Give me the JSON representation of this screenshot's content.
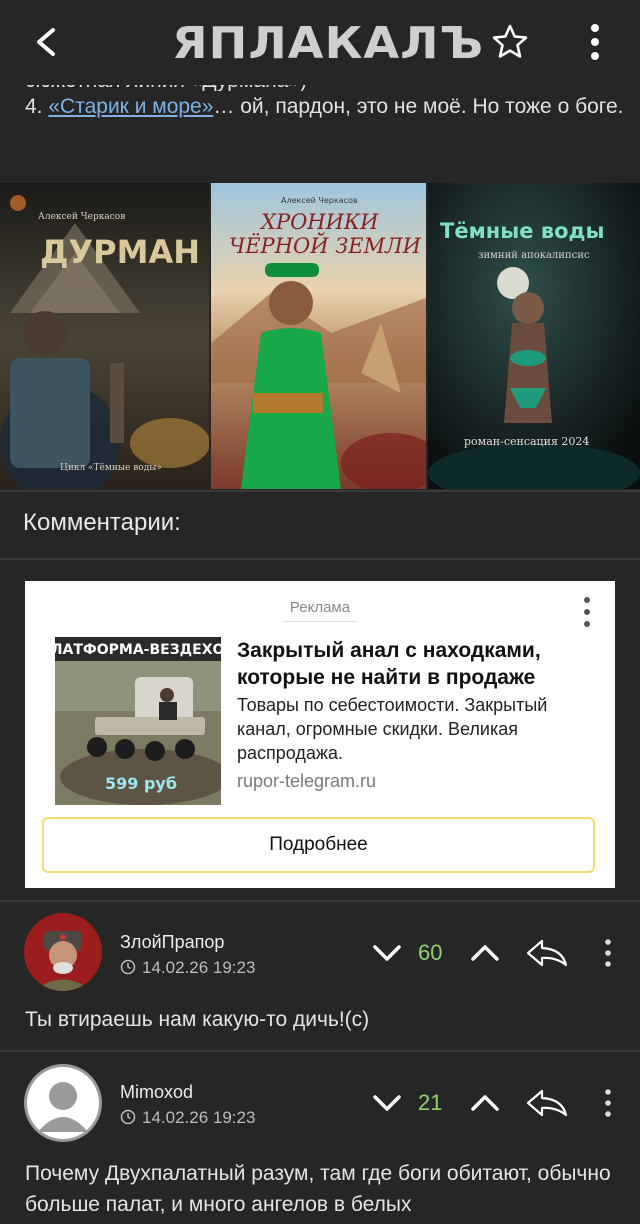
{
  "header": {
    "logo_text": "ЯПЛАКАЛЪ"
  },
  "post": {
    "line_clipped": "сюжетная линия «Дурмана»)",
    "line4_prefix": "4. ",
    "line4_link": "«Старик и море»",
    "line4_rest": "… ой, пардон, это не моё. Но тоже о боге."
  },
  "covers": [
    {
      "author": "Алексей Черкасов",
      "title": "ДУРМАН",
      "footer": "Цикл «Тёмные воды»"
    },
    {
      "author": "Алексей Черкасов",
      "title_line1": "ХРОНИКИ",
      "title_line2": "ЧЁРНОЙ ЗЕМЛИ"
    },
    {
      "title": "Тёмные воды",
      "subtitle": "зимний апокалипсис",
      "footer": "роман-сенсация 2024"
    }
  ],
  "comments_title": "Комментарии:",
  "ad": {
    "label": "Реклама",
    "thumb_banner": "ПЛАТФОРМА-ВЕЗДЕХОД",
    "thumb_price": "599 руб",
    "headline": "Закрытый анал с находками, которые не найти в продаже",
    "description": "Товары по себестоимости. Закрытый канал, огромные скидки. Великая распродажа.",
    "domain": "rupor-telegram.ru",
    "button": "Подробнее"
  },
  "comments": [
    {
      "author": "ЗлойПрапор",
      "date": "14.02.26 19:23",
      "score": "60",
      "text": "Ты втираешь нам какую-то дичь!(с)"
    },
    {
      "author": "Mimoxod",
      "date": "14.02.26 19:23",
      "score": "21",
      "text": "Почему Двухпалатный разум, там где боги обитают, обычно больше палат, и много ангелов в белых"
    }
  ],
  "colors": {
    "background": "#262626",
    "link": "#7fb0e6",
    "score": "#8fd16b",
    "ad_button_border": "#f2dc6e"
  }
}
